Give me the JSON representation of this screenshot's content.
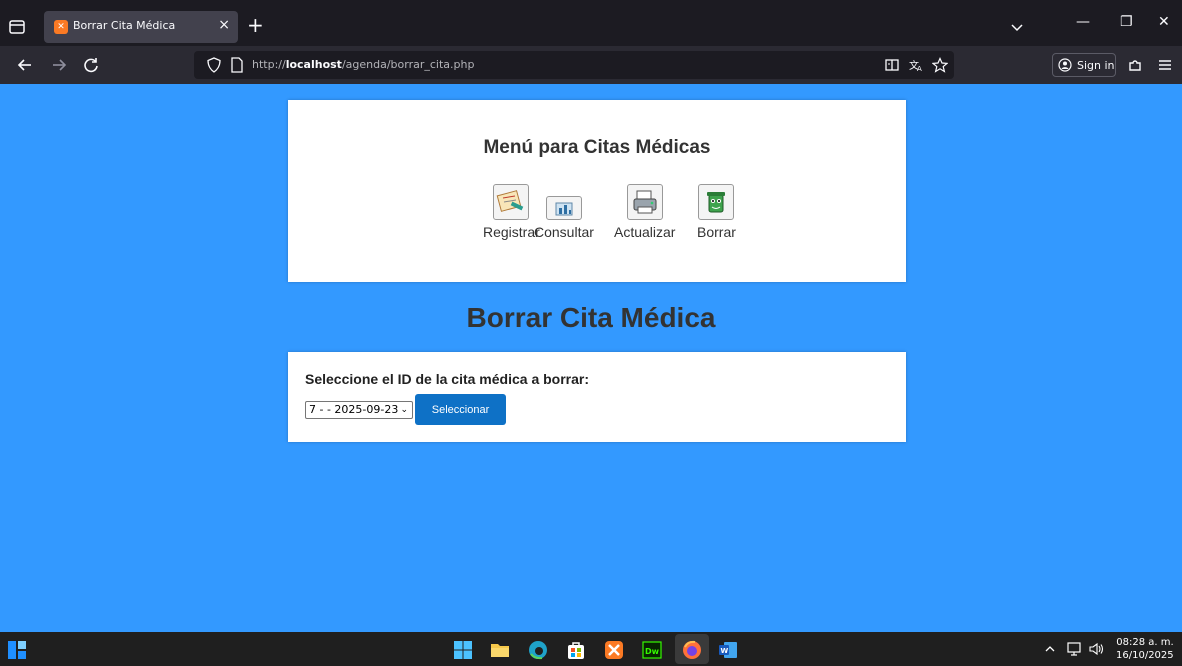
{
  "browser": {
    "tab_title": "Borrar Cita Médica",
    "tab_close": "×",
    "new_tab": "+",
    "url_prefix": "http://",
    "url_host": "localhost",
    "url_path": "/agenda/borrar_cita.php",
    "sign_in": "Sign in",
    "win_minimize": "—",
    "win_restore": "❐",
    "win_close": "✕"
  },
  "menu": {
    "title": "Menú para Citas Médicas",
    "items": [
      {
        "label": "Registrar",
        "icon": "register-icon"
      },
      {
        "label": "Consultar",
        "icon": "consult-icon"
      },
      {
        "label": "Actualizar",
        "icon": "update-icon"
      },
      {
        "label": "Borrar",
        "icon": "delete-icon"
      }
    ]
  },
  "page": {
    "title": "Borrar Cita Médica"
  },
  "form": {
    "label": "Seleccione el ID de la cita médica a borrar:",
    "selected_option": "7 - - 2025-09-23",
    "button_label": "Seleccionar"
  },
  "taskbar": {
    "time": "08:28 a. m.",
    "date": "16/10/2025"
  },
  "colors": {
    "page_background": "#3399ff",
    "button": "#0e71c6",
    "panel": "#ffffff",
    "heading_text": "#333333"
  }
}
